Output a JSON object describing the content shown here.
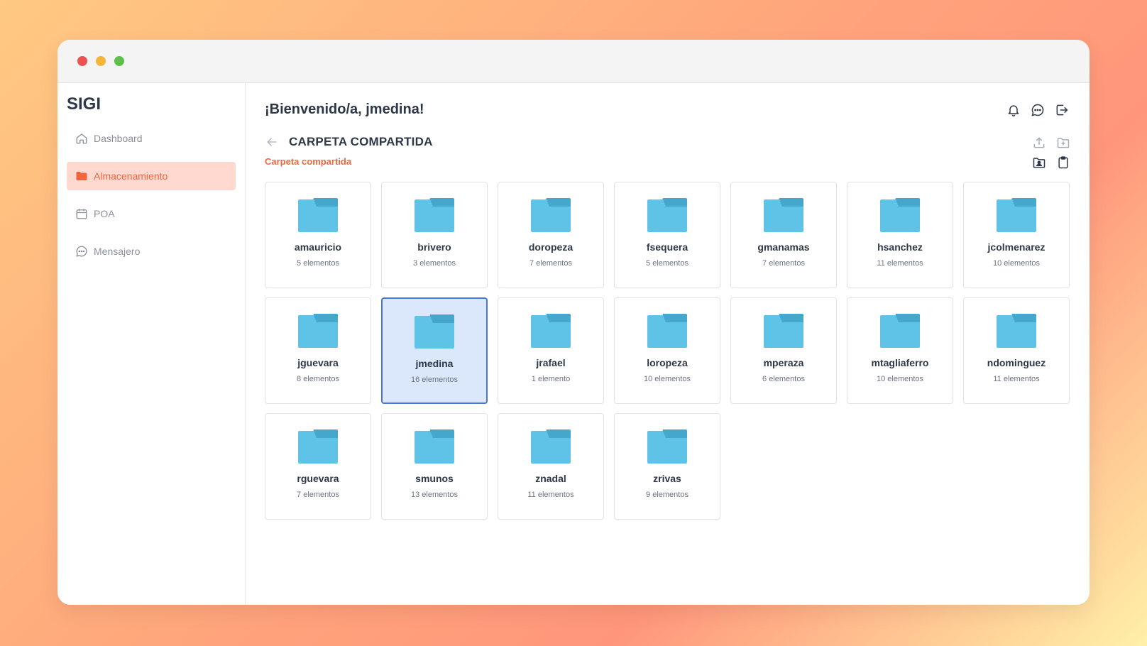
{
  "window": {
    "dots": [
      "#e95452",
      "#f4b63a",
      "#5ec04c"
    ]
  },
  "sidebar": {
    "brand": "SIGI",
    "items": [
      {
        "label": "Dashboard",
        "icon": "home-icon",
        "active": false
      },
      {
        "label": "Almacenamiento",
        "icon": "folder-icon",
        "active": true
      },
      {
        "label": "POA",
        "icon": "calendar-icon",
        "active": false
      },
      {
        "label": "Mensajero",
        "icon": "chat-icon",
        "active": false
      }
    ]
  },
  "header": {
    "welcome": "¡Bienvenido/a, jmedina!",
    "icons": [
      "bell-icon",
      "chat-icon",
      "logout-icon"
    ]
  },
  "breadcrumb": {
    "title": "CARPETA COMPARTIDA",
    "subtitle": "Carpeta compartida"
  },
  "toolbar": {
    "icons_top": [
      "upload-icon",
      "new-folder-icon"
    ],
    "icons_bottom": [
      "shared-folder-icon",
      "clipboard-icon"
    ]
  },
  "folders": [
    {
      "name": "amauricio",
      "count": "5 elementos",
      "selected": false
    },
    {
      "name": "brivero",
      "count": "3 elementos",
      "selected": false
    },
    {
      "name": "doropeza",
      "count": "7 elementos",
      "selected": false
    },
    {
      "name": "fsequera",
      "count": "5 elementos",
      "selected": false
    },
    {
      "name": "gmanamas",
      "count": "7 elementos",
      "selected": false
    },
    {
      "name": "hsanchez",
      "count": "11 elementos",
      "selected": false
    },
    {
      "name": "jcolmenarez",
      "count": "10 elementos",
      "selected": false
    },
    {
      "name": "jguevara",
      "count": "8 elementos",
      "selected": false
    },
    {
      "name": "jmedina",
      "count": "16 elementos",
      "selected": true
    },
    {
      "name": "jrafael",
      "count": "1 elemento",
      "selected": false
    },
    {
      "name": "loropeza",
      "count": "10 elementos",
      "selected": false
    },
    {
      "name": "mperaza",
      "count": "6 elementos",
      "selected": false
    },
    {
      "name": "mtagliaferro",
      "count": "10 elementos",
      "selected": false
    },
    {
      "name": "ndominguez",
      "count": "11 elementos",
      "selected": false
    },
    {
      "name": "rguevara",
      "count": "7 elementos",
      "selected": false
    },
    {
      "name": "smunos",
      "count": "13 elementos",
      "selected": false
    },
    {
      "name": "znadal",
      "count": "11 elementos",
      "selected": false
    },
    {
      "name": "zrivas",
      "count": "9 elementos",
      "selected": false
    }
  ],
  "colors": {
    "accent": "#f0673f",
    "folder_body": "#5ec3e7",
    "folder_tab": "#47a6cc",
    "selected_bg": "#dbe8fc",
    "selected_border": "#4a77d6"
  }
}
